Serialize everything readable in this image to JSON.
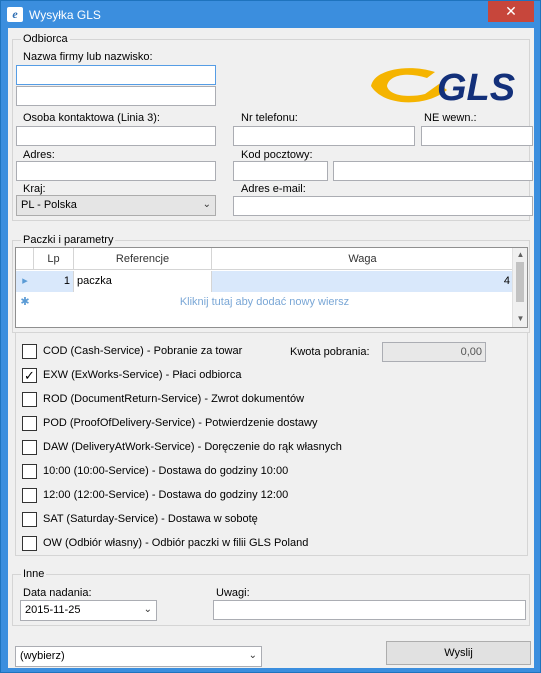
{
  "window": {
    "title": "Wysyłka GLS",
    "close_glyph": "✕",
    "app_icon": "e"
  },
  "recipient": {
    "legend": "Odbiorca",
    "company_label": "Nazwa firmy lub nazwisko:",
    "company_value": "",
    "company_line2_value": "",
    "contact_label": "Osoba kontaktowa (Linia 3):",
    "contact_value": "",
    "phone_label": "Nr telefonu:",
    "phone_value": "",
    "ne_label": "NE wewn.:",
    "ne_value": "",
    "address_label": "Adres:",
    "address_value": "",
    "postal_label": "Kod pocztowy:",
    "postal_value": "",
    "city_value": "",
    "country_label": "Kraj:",
    "country_value": "PL  - Polska",
    "email_label": "Adres e-mail:",
    "email_value": ""
  },
  "logo": {
    "text": "GLS",
    "brand_yellow": "#f5b400",
    "brand_blue": "#13307a"
  },
  "parcels": {
    "legend": "Paczki i parametry",
    "columns": [
      "Lp",
      "Referencje",
      "Waga"
    ],
    "rows": [
      {
        "lp": "1",
        "ref": "paczka",
        "weight": "4"
      }
    ],
    "new_row_text": "Kliknij tutaj aby dodać nowy wiersz",
    "row_indicator": "▸",
    "new_row_indicator": "✱"
  },
  "services": {
    "cod_amount_label": "Kwota pobrania:",
    "cod_amount_value": "0,00",
    "items": [
      {
        "label": "COD (Cash-Service) - Pobranie za towar",
        "checked": ""
      },
      {
        "label": "EXW (ExWorks-Service) - Płaci odbiorca",
        "checked": "✓"
      },
      {
        "label": "ROD (DocumentReturn-Service) - Zwrot dokumentów",
        "checked": ""
      },
      {
        "label": "POD (ProofOfDelivery-Service) - Potwierdzenie dostawy",
        "checked": ""
      },
      {
        "label": "DAW (DeliveryAtWork-Service) - Doręczenie do rąk własnych",
        "checked": ""
      },
      {
        "label": "10:00 (10:00-Service) - Dostawa do godziny 10:00",
        "checked": ""
      },
      {
        "label": "12:00 (12:00-Service) - Dostawa do godziny 12:00",
        "checked": ""
      },
      {
        "label": "SAT (Saturday-Service) - Dostawa w sobotę",
        "checked": ""
      },
      {
        "label": "OW (Odbiór własny) - Odbiór paczki w filii GLS Poland",
        "checked": ""
      }
    ]
  },
  "other": {
    "legend": "Inne",
    "date_label": "Data nadania:",
    "date_value": "2015-11-25",
    "notes_label": "Uwagi:",
    "notes_value": ""
  },
  "footer": {
    "select_value": "(wybierz)",
    "send_label": "Wyslij"
  },
  "dropdown_arrow": "⌄"
}
